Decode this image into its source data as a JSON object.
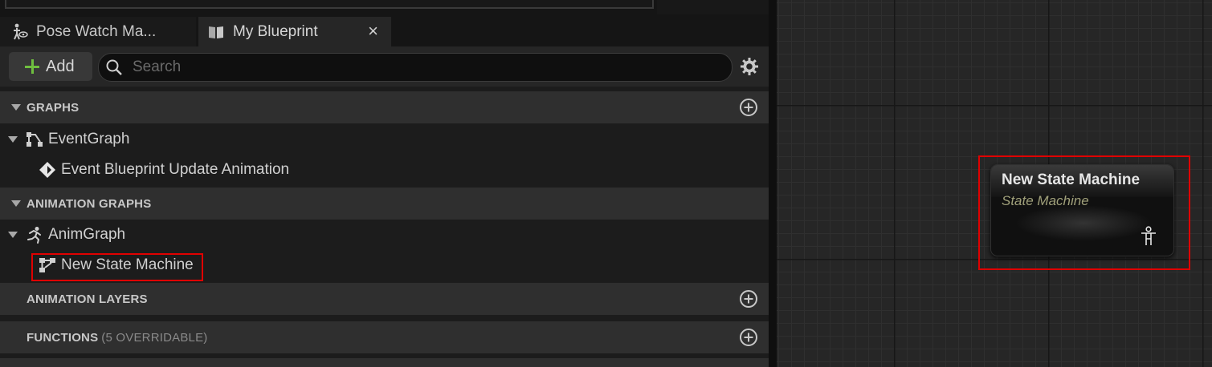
{
  "tabs": [
    {
      "label": "Pose Watch Ma...",
      "icon": "pose-watch-icon"
    },
    {
      "label": "My Blueprint",
      "icon": "book-icon",
      "close": "×"
    }
  ],
  "toolbar": {
    "add_label": "Add",
    "search_placeholder": "Search",
    "search_value": ""
  },
  "sections": {
    "graphs": {
      "title": "GRAPHS"
    },
    "animation_graphs": {
      "title": "ANIMATION GRAPHS"
    },
    "animation_layers": {
      "title": "ANIMATION LAYERS"
    },
    "functions": {
      "title": "FUNCTIONS",
      "suffix": "(5 OVERRIDABLE)"
    }
  },
  "tree": {
    "event_graph": {
      "label": "EventGraph",
      "icon": "event-graph-icon"
    },
    "event_update": {
      "label": "Event Blueprint Update Animation",
      "icon": "event-diamond-icon"
    },
    "anim_graph": {
      "label": "AnimGraph",
      "icon": "running-figure-icon"
    },
    "state_machine": {
      "label": "New State Machine",
      "icon": "state-machine-icon"
    }
  },
  "graph_node": {
    "title": "New State Machine",
    "subtitle": "State Machine",
    "icon": "pose-figure-icon"
  },
  "colors": {
    "highlight": "#e00000",
    "add_plus": "#6fbf3f",
    "node_subtitle": "#a0a07a"
  }
}
